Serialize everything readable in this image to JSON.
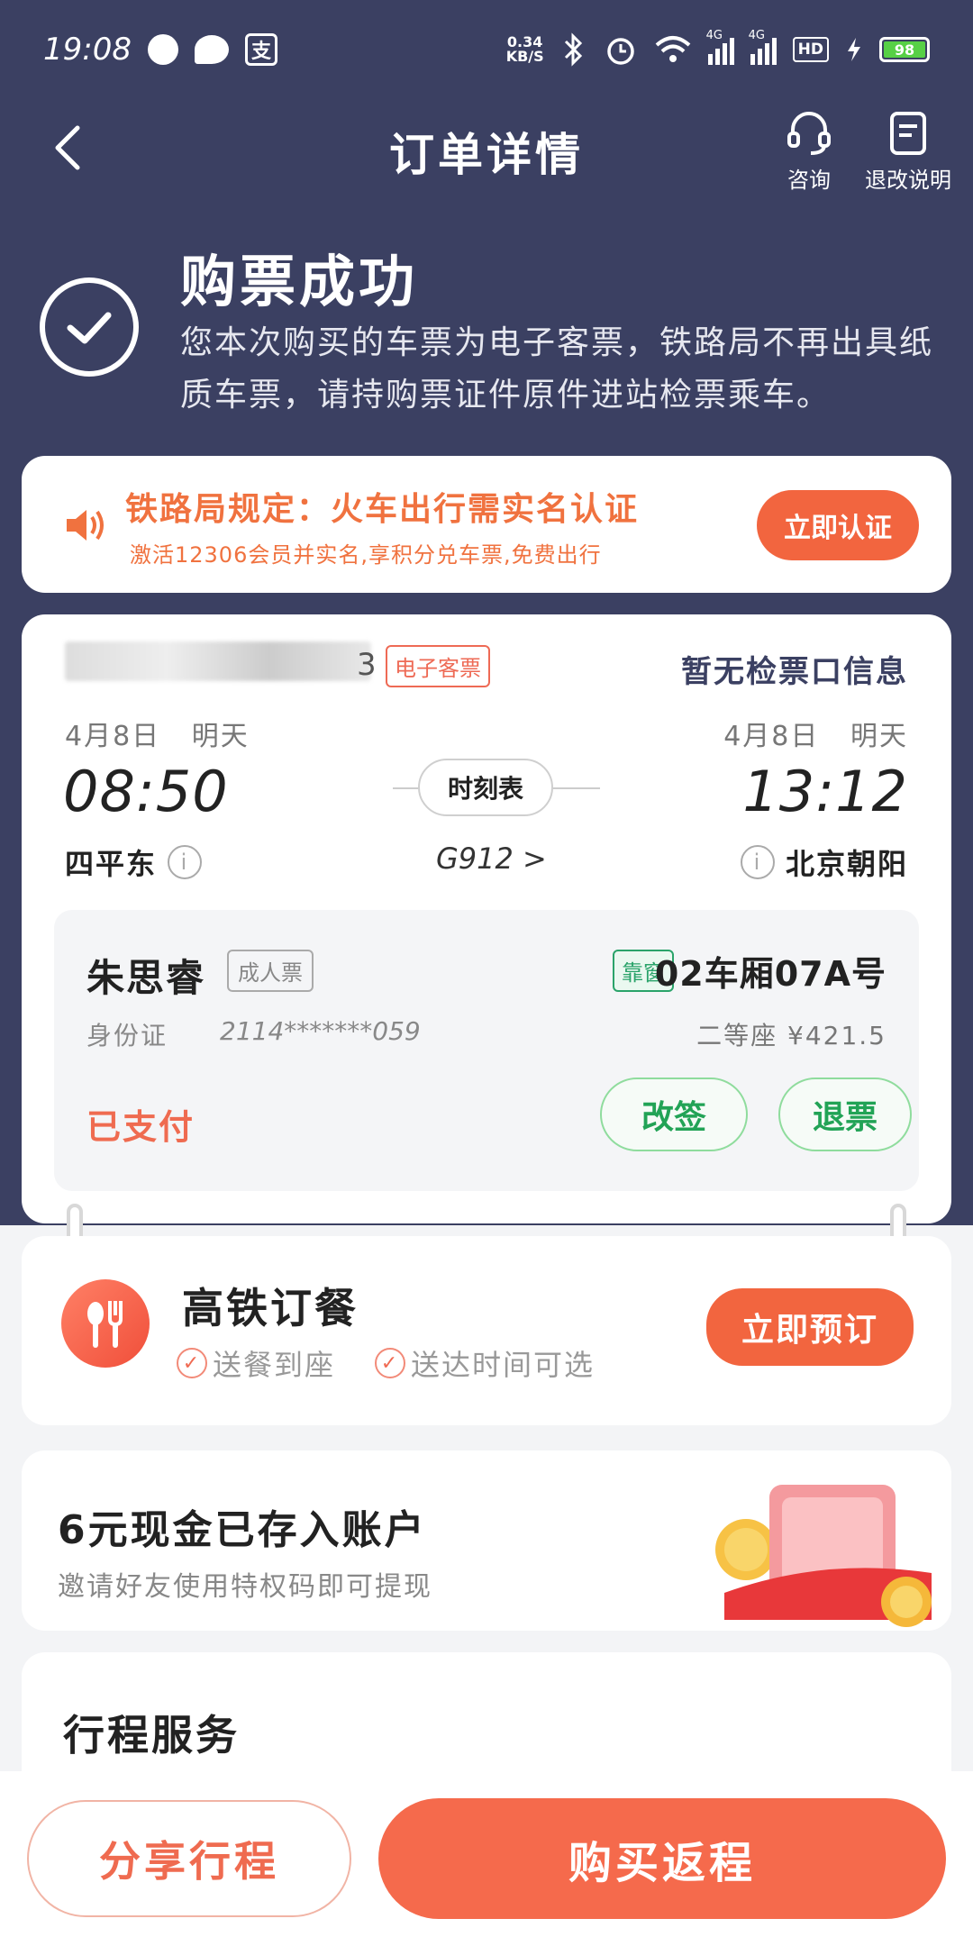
{
  "status_bar": {
    "time": "19:08",
    "net_speed_value": "0.34",
    "net_speed_unit": "KB/S",
    "signal1_label": "4G",
    "signal2_label": "4G",
    "hd_label": "HD",
    "battery": "98",
    "icons": [
      "chat-bubble-icon",
      "wechat-icon",
      "alipay-icon",
      "bluetooth-icon",
      "alarm-icon",
      "wifi-icon",
      "signal-icon",
      "charging-icon",
      "battery-icon"
    ]
  },
  "header": {
    "title": "订单详情",
    "consult_label": "咨询",
    "refund_info_label": "退改说明"
  },
  "success": {
    "title": "购票成功",
    "description": "您本次购买的车票为电子客票，铁路局不再出具纸质车票，请持购票证件原件进站检票乘车。"
  },
  "realname": {
    "title": "铁路局规定：火车出行需实名认证",
    "subtitle": "激活12306会员并实名,享积分兑车票,免费出行",
    "button": "立即认证",
    "accent": "#f0723f"
  },
  "ticket": {
    "train_no_tail": "3",
    "e_ticket_tag": "电子客票",
    "gate_info": "暂无检票口信息",
    "departure": {
      "date": "4月8日",
      "day": "明天",
      "time": "08:50",
      "station": "四平东"
    },
    "arrival": {
      "date": "4月8日",
      "day": "明天",
      "time": "13:12",
      "station": "北京朝阳"
    },
    "schedule_label": "时刻表",
    "train_code": "G912 >",
    "passenger": {
      "name": "朱思睿",
      "ticket_type": "成人票",
      "seat_badge": "靠窗",
      "seat_no": "02车厢07A号",
      "id_type": "身份证",
      "id_no": "2114*******059",
      "seat_class_price": "二等座 ¥421.5",
      "status": "已支付",
      "change_button": "改签",
      "refund_button": "退票"
    }
  },
  "meal": {
    "title": "高铁订餐",
    "feature1": "送餐到座",
    "feature2": "送达时间可选",
    "button": "立即预订"
  },
  "cash": {
    "title": "6元现金已存入账户",
    "subtitle": "邀请好友使用特权码即可提现"
  },
  "service": {
    "title": "行程服务"
  },
  "bottom": {
    "share": "分享行程",
    "return": "购买返程"
  },
  "colors": {
    "header_bg": "#3b4062",
    "brand_orange": "#f56a4c",
    "green": "#22a356"
  }
}
